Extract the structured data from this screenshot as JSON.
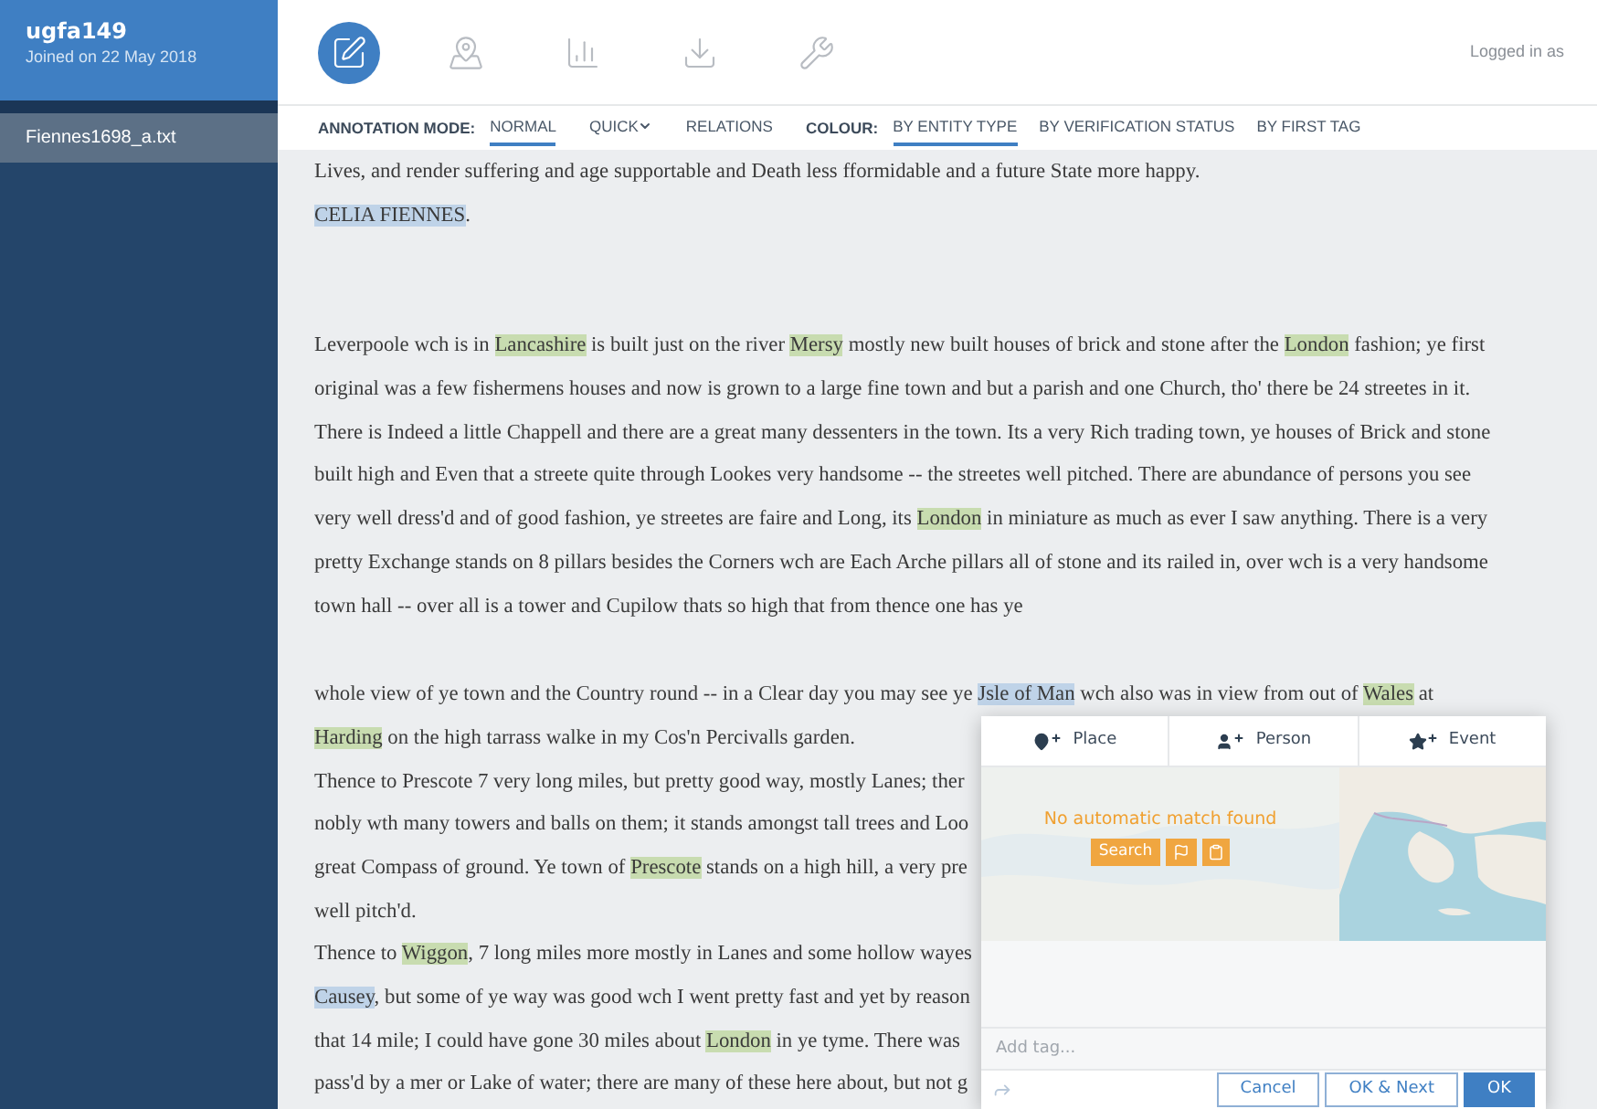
{
  "user": {
    "name": "ugfa149",
    "joined": "Joined on 22 May 2018"
  },
  "files": [
    {
      "label": "Fiennes1698_a.txt",
      "selected": true
    }
  ],
  "tools": [
    {
      "kind": "annotate",
      "selected": true
    },
    {
      "kind": "map",
      "selected": false
    },
    {
      "kind": "chart",
      "selected": false
    },
    {
      "kind": "download",
      "selected": false
    },
    {
      "kind": "tools",
      "selected": false
    }
  ],
  "login_status": "Logged in as",
  "annotation_mode": {
    "label": "ANNOTATION MODE:",
    "options": [
      {
        "label": "NORMAL",
        "selected": true,
        "has_menu": false
      },
      {
        "label": "QUICK",
        "selected": false,
        "has_menu": true
      },
      {
        "label": "RELATIONS",
        "selected": false,
        "has_menu": false
      }
    ]
  },
  "colour": {
    "label": "COLOUR:",
    "options": [
      {
        "label": "BY ENTITY TYPE",
        "selected": true
      },
      {
        "label": "BY VERIFICATION STATUS",
        "selected": false
      },
      {
        "label": "BY FIRST TAG",
        "selected": false
      }
    ]
  },
  "paragraphs": [
    {
      "lines": [
        [
          {
            "text": "Lives, and render suffering and age supportable and Death less fformidable and a future State more happy."
          }
        ],
        [
          {
            "text": "CELIA FIENNES",
            "color": "#bfd3e8"
          },
          {
            "text": "."
          }
        ]
      ]
    },
    {
      "lines": [
        [
          {
            "text": "Leverpoole wch is in "
          },
          {
            "text": "Lancashire",
            "color": "#c8dcb0"
          },
          {
            "text": " is built just on the river "
          },
          {
            "text": "Mersy",
            "color": "#c8dcb0"
          },
          {
            "text": " mostly new built houses of brick and stone after the "
          },
          {
            "text": "London",
            "color": "#c8dcb0"
          },
          {
            "text": " fashion; ye first"
          }
        ],
        [
          {
            "text": "original was a few fishermens houses and now is grown to a large fine town and but a parish and one Church, tho' there be 24 streetes in it."
          }
        ],
        [
          {
            "text": "There is Indeed a little Chappell and there are a great many dessenters in the town. Its a very Rich trading town, ye houses of Brick and stone"
          }
        ],
        [
          {
            "text": "built high and Even that a streete quite through Lookes very handsome -- the streetes well pitched. There are abundance of persons you see"
          }
        ],
        [
          {
            "text": "very well dress'd and of good fashion, ye streetes are faire and Long, its "
          },
          {
            "text": "London",
            "color": "#c8dcb0"
          },
          {
            "text": " in miniature as much as ever I saw anything. There is a very"
          }
        ],
        [
          {
            "text": "pretty Exchange stands on 8 pillars besides the Corners wch are Each Arche pillars all of stone and its railed in, over wch is a very handsome"
          }
        ],
        [
          {
            "text": "town hall -- over all is a tower and Cupilow thats so high that from thence one has ye"
          }
        ]
      ]
    },
    {
      "lines": [
        [
          {
            "text": "whole view of ye town and the Country round -- in a Clear day you may see ye "
          },
          {
            "text": "Jsle of Man",
            "color": "#bfd3e8"
          },
          {
            "text": " wch also was in view from out of "
          },
          {
            "text": "Wales",
            "color": "#c8dcb0"
          },
          {
            "text": " at"
          }
        ],
        [
          {
            "text": "Harding",
            "color": "#c8dcb0"
          },
          {
            "text": " on the high tarrass walke in my Cos'n Percivalls garden."
          }
        ],
        [
          {
            "text": "Thence to Prescote 7 very long miles, but pretty good way, mostly Lanes; ther"
          }
        ],
        [
          {
            "text": "nobly wth many towers and balls on them; it stands amongst tall trees and Loo"
          }
        ],
        [
          {
            "text": "great Compass of ground. Ye town of "
          },
          {
            "text": "Prescote",
            "color": "#c8dcb0"
          },
          {
            "text": " stands on a high hill, a very pre"
          }
        ],
        [
          {
            "text": "well pitch'd."
          }
        ],
        [
          {
            "text": "Thence to "
          },
          {
            "text": "Wiggon",
            "color": "#c8dcb0"
          },
          {
            "text": ", 7 long miles more mostly in Lanes and some hollow wayes"
          }
        ],
        [
          {
            "text": "Causey",
            "color": "#bfd3e8"
          },
          {
            "text": ", but some of ye way was good wch I went pretty fast and yet by reason"
          }
        ],
        [
          {
            "text": "that 14 mile; I could have gone 30 miles about "
          },
          {
            "text": "London",
            "color": "#c8dcb0"
          },
          {
            "text": " in ye tyme. There was"
          }
        ],
        [
          {
            "text": "pass'd by a mer or Lake of water; there are many of these here about, but not g"
          }
        ]
      ]
    }
  ],
  "popup": {
    "tabs": [
      {
        "kind": "place",
        "label": "Place"
      },
      {
        "kind": "person",
        "label": "Person"
      },
      {
        "kind": "event",
        "label": "Event"
      }
    ],
    "map": {
      "kind": "picture",
      "message": "No automatic match found",
      "search": "Search"
    },
    "tag_field": {
      "placeholder": "Add tag..."
    },
    "buttons": [
      {
        "label": "Cancel",
        "primary": false
      },
      {
        "label": "OK & Next",
        "primary": false
      },
      {
        "label": "OK",
        "primary": true
      }
    ]
  }
}
